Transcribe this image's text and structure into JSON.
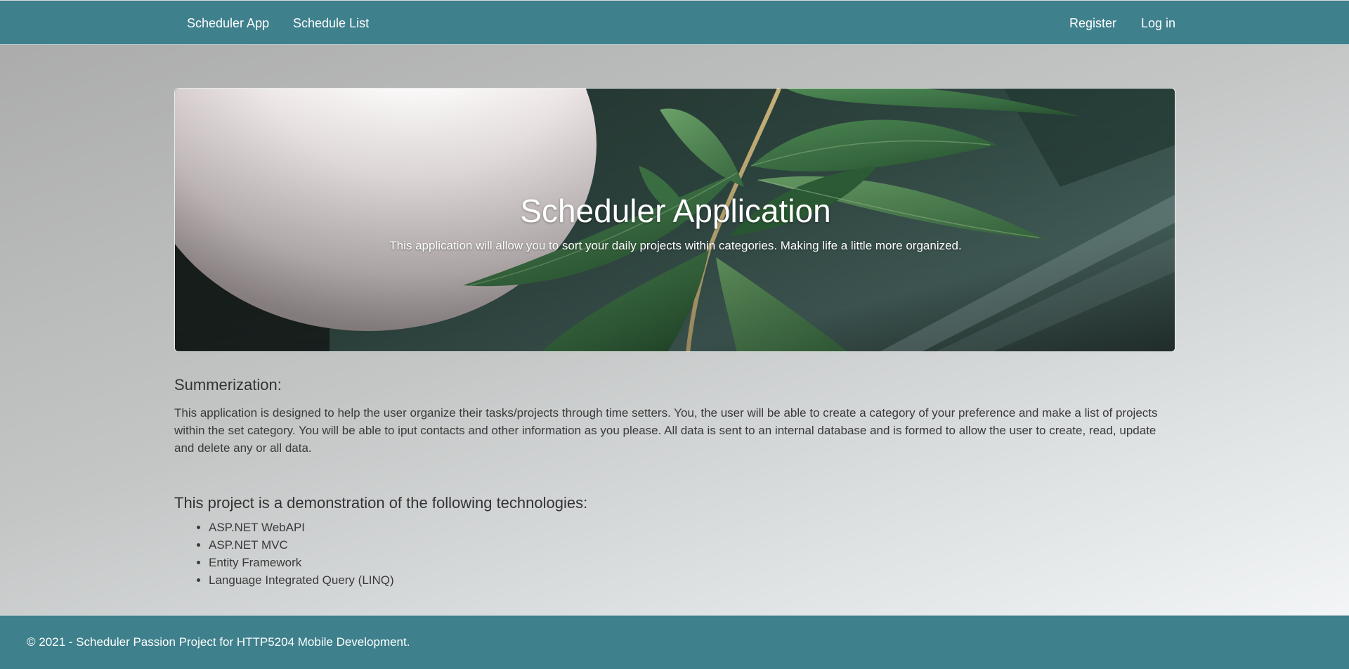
{
  "navbar": {
    "brand": "Scheduler App",
    "schedule_list": "Schedule List",
    "register": "Register",
    "login": "Log in"
  },
  "hero": {
    "title": "Scheduler Application",
    "lead": "This application will allow you to sort your daily projects within categories. Making life a little more organized."
  },
  "summary": {
    "heading": "Summerization:",
    "text": "This application is designed to help the user organize their tasks/projects through time setters. You, the user will be able to create a category of your preference and make a list of projects within the set category. You will be able to iput contacts and other information as you please. All data is sent to an internal database and is formed to allow the user to create, read, update and delete any or all data."
  },
  "technologies": {
    "heading": "This project is a demonstration of the following technologies:",
    "items": [
      "ASP.NET WebAPI",
      "ASP.NET MVC",
      "Entity Framework",
      "Language Integrated Query (LINQ)"
    ]
  },
  "footer": {
    "text": "© 2021 - Scheduler Passion Project for HTTP5204 Mobile Development."
  },
  "colors": {
    "navbar_bg": "#3e808c",
    "footer_bg": "#3e808c",
    "text": "#333333"
  }
}
